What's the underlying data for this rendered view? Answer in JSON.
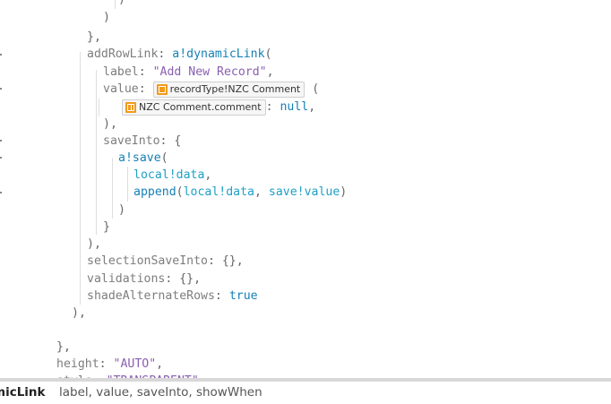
{
  "editor": {
    "lines": [
      {
        "tokens": [
          {
            "t": ")",
            "c": "punc"
          }
        ]
      },
      {
        "tokens": [
          {
            "t": ")",
            "c": "punc"
          }
        ]
      },
      {
        "tokens": [
          {
            "t": "},",
            "c": "punc"
          }
        ]
      },
      {
        "tokens": [
          {
            "t": "addRowLink",
            "c": "ident"
          },
          {
            "t": ": ",
            "c": "punc"
          },
          {
            "t": "a!dynamicLink",
            "c": "fn"
          },
          {
            "t": "(",
            "c": "punc"
          }
        ]
      },
      {
        "tokens": [
          {
            "t": "label",
            "c": "ident"
          },
          {
            "t": ": ",
            "c": "punc"
          },
          {
            "t": "\"Add New Record\"",
            "c": "str"
          },
          {
            "t": ",",
            "c": "punc"
          }
        ]
      },
      {
        "tokens": [
          {
            "t": "value",
            "c": "ident"
          },
          {
            "t": ": ",
            "c": "punc"
          },
          {
            "chip": "recordType!NZC Comment",
            "icon": "record-type-icon"
          },
          {
            "t": " (",
            "c": "punc"
          }
        ]
      },
      {
        "tokens": [
          {
            "chip": "NZC Comment.comment",
            "icon": "record-field-icon"
          },
          {
            "t": ": ",
            "c": "punc"
          },
          {
            "t": "null",
            "c": "kw"
          },
          {
            "t": ",",
            "c": "punc"
          }
        ]
      },
      {
        "tokens": [
          {
            "t": "),",
            "c": "punc"
          }
        ]
      },
      {
        "tokens": [
          {
            "t": "saveInto",
            "c": "ident"
          },
          {
            "t": ": {",
            "c": "punc"
          }
        ]
      },
      {
        "tokens": [
          {
            "t": "a!save",
            "c": "fn"
          },
          {
            "t": "(",
            "c": "punc"
          }
        ]
      },
      {
        "tokens": [
          {
            "t": "local!data",
            "c": "lv"
          },
          {
            "t": ",",
            "c": "punc"
          }
        ]
      },
      {
        "tokens": [
          {
            "t": "append",
            "c": "fn"
          },
          {
            "t": "(",
            "c": "punc"
          },
          {
            "t": "local!data",
            "c": "lv"
          },
          {
            "t": ", ",
            "c": "punc"
          },
          {
            "t": "save!value",
            "c": "lv"
          },
          {
            "t": ")",
            "c": "punc"
          }
        ]
      },
      {
        "tokens": [
          {
            "t": ")",
            "c": "punc"
          }
        ]
      },
      {
        "tokens": [
          {
            "t": "}",
            "c": "punc"
          }
        ]
      },
      {
        "tokens": [
          {
            "t": "),",
            "c": "punc"
          }
        ]
      },
      {
        "tokens": [
          {
            "t": "selectionSaveInto",
            "c": "ident"
          },
          {
            "t": ": {},",
            "c": "punc"
          }
        ]
      },
      {
        "tokens": [
          {
            "t": "validations",
            "c": "ident"
          },
          {
            "t": ": {},",
            "c": "punc"
          }
        ]
      },
      {
        "tokens": [
          {
            "t": "shadeAlternateRows",
            "c": "ident"
          },
          {
            "t": ": ",
            "c": "punc"
          },
          {
            "t": "true",
            "c": "kw"
          }
        ]
      },
      {
        "tokens": [
          {
            "t": "),",
            "c": "punc"
          }
        ]
      },
      {
        "tokens": []
      },
      {
        "tokens": [
          {
            "t": "},",
            "c": "punc"
          }
        ]
      },
      {
        "tokens": [
          {
            "t": "height",
            "c": "ident"
          },
          {
            "t": ": ",
            "c": "punc"
          },
          {
            "t": "\"AUTO\"",
            "c": "str"
          },
          {
            "t": ",",
            "c": "punc"
          }
        ]
      },
      {
        "tokens": [
          {
            "t": "style",
            "c": "ident"
          },
          {
            "t": ": ",
            "c": "punc"
          },
          {
            "t": "\"TRANSPARENT\"",
            "c": "str"
          }
        ]
      }
    ]
  },
  "hint": {
    "function": "micLink",
    "params": "label, value, saveInto, showWhen"
  }
}
